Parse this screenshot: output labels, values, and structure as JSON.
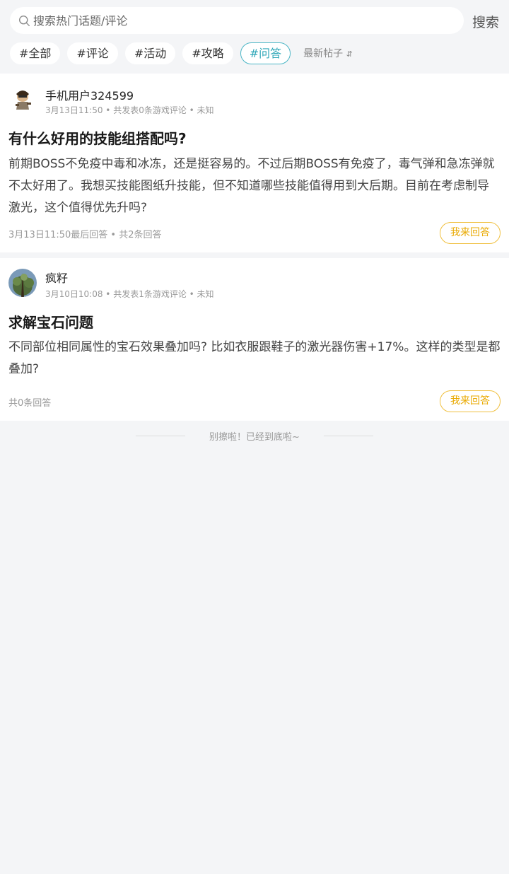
{
  "search": {
    "placeholder": "搜索热门话题/评论",
    "button_label": "搜索"
  },
  "tags": [
    {
      "label": "#全部",
      "active": false
    },
    {
      "label": "#评论",
      "active": false
    },
    {
      "label": "#活动",
      "active": false
    },
    {
      "label": "#攻略",
      "active": false
    },
    {
      "label": "#问答",
      "active": true
    }
  ],
  "sort": {
    "label": "最新帖子",
    "icon": "sort-arrows-icon"
  },
  "posts": [
    {
      "author": "手机用户324599",
      "meta": "3月13日11:50 • 共发表0条游戏评论 • 未知",
      "title": "有什么好用的技能组搭配吗?",
      "body": "前期BOSS不免疫中毒和冰冻，还是挺容易的。不过后期BOSS有免疫了，毒气弹和急冻弹就不太好用了。我想买技能图纸升技能，但不知道哪些技能值得用到大后期。目前在考虑制导激光，这个值得优先升吗?",
      "footer": "3月13日11:50最后回答 • 共2条回答",
      "answer_label": "我来回答"
    },
    {
      "author": "疯籽",
      "meta": "3月10日10:08 • 共发表1条游戏评论 • 未知",
      "title": "求解宝石问题",
      "body": "不同部位相同属性的宝石效果叠加吗? 比如衣服跟鞋子的激光器伤害+17%。这样的类型是都叠加?",
      "footer": "共0条回答",
      "answer_label": "我来回答"
    }
  ],
  "bottom_note": "别擦啦！已经到底啦~",
  "colors": {
    "background": "#f4f5f7",
    "accent_active_tag": "#2fa7b8",
    "answer_button": "#e9a900"
  }
}
